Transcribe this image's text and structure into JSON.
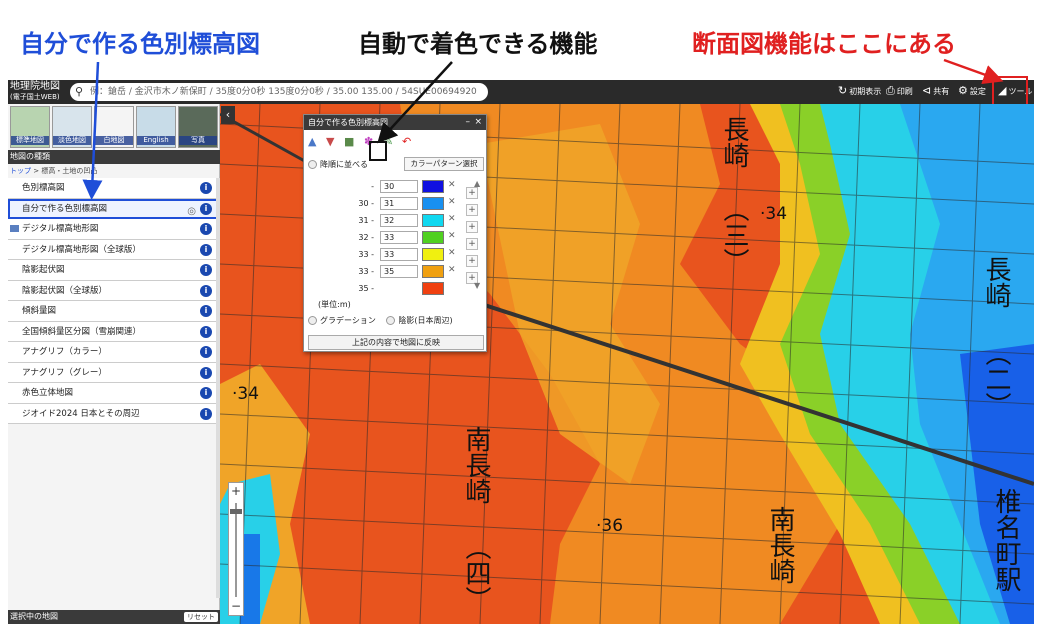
{
  "captions": {
    "left": "自分で作る色別標高図",
    "middle": "自動で着色できる機能",
    "right": "断面図機能はここにある"
  },
  "topbar": {
    "logo_main": "地理院地図",
    "logo_sub": "(電子国土WEB)",
    "search_text": "例：鎗岳 / 金沢市木ノ新保町 / 35度0分0秒 135度0分0秒 / 35.00 135.00 / 54SUE00694920",
    "btn_init": "初期表示",
    "btn_print": "印刷",
    "btn_share": "共有",
    "btn_settings": "設定",
    "btn_tools": "ツール"
  },
  "sidebar": {
    "thumbs": [
      "標準地図",
      "淡色地図",
      "白地図",
      "English",
      "写真"
    ],
    "section_title": "地図の種類",
    "breadcrumb_top": "トップ",
    "breadcrumb_rest": " > 標高・土地の凹凸",
    "layers": [
      {
        "label": "色別標高図",
        "folder": false,
        "highlight": false
      },
      {
        "label": "自分で作る色別標高図",
        "folder": false,
        "highlight": true
      },
      {
        "label": "デジタル標高地形図",
        "folder": true,
        "highlight": false
      },
      {
        "label": "デジタル標高地形図（全球版）",
        "folder": false,
        "highlight": false
      },
      {
        "label": "陰影起伏図",
        "folder": false,
        "highlight": false
      },
      {
        "label": "陰影起伏図（全球版）",
        "folder": false,
        "highlight": false
      },
      {
        "label": "傾斜量図",
        "folder": false,
        "highlight": false
      },
      {
        "label": "全国傾斜量区分図（雪崩関連）",
        "folder": false,
        "highlight": false
      },
      {
        "label": "アナグリフ（カラー）",
        "folder": false,
        "highlight": false
      },
      {
        "label": "アナグリフ（グレー）",
        "folder": false,
        "highlight": false
      },
      {
        "label": "赤色立体地図",
        "folder": false,
        "highlight": false
      },
      {
        "label": "ジオイド2024 日本とその周辺",
        "folder": false,
        "highlight": false
      }
    ],
    "selected_title": "選択中の地図",
    "reset_label": "リセット"
  },
  "panel": {
    "title": "自分で作る色別標高図",
    "sort_label": "降順に並べる",
    "pattern_label": "カラーパターン選択",
    "rows": [
      {
        "from": "",
        "to": "30",
        "color": "#1010e0"
      },
      {
        "from": "30",
        "to": "31",
        "color": "#1890f0"
      },
      {
        "from": "31",
        "to": "32",
        "color": "#10d8f0"
      },
      {
        "from": "32",
        "to": "33",
        "color": "#50d020"
      },
      {
        "from": "33",
        "to": "33",
        "color": "#f0f010"
      },
      {
        "from": "33",
        "to": "35",
        "color": "#f0a010"
      },
      {
        "from": "35",
        "to": "",
        "color": "#f04010"
      }
    ],
    "unit": "(単位:m)",
    "gradation": "グラデーション",
    "shading": "陰影(日本周辺)",
    "apply": "上記の内容で地図に反映"
  },
  "map": {
    "labels": {
      "nagasaki1": "長崎",
      "nagasaki3": "（三）",
      "elev34a": "·34",
      "nagasaki_right": "長崎",
      "nagasaki2": "（二）",
      "elev34b": "·34",
      "minaminagasaki": "南長崎",
      "yon": "（四）",
      "elev36": "·36",
      "minaminagasaki2": "南長崎",
      "shiinamachi": "椎名町駅",
      "station": "駅"
    }
  },
  "colors": {
    "caption_blue": "#1f4ed8",
    "caption_red": "#e02020",
    "map_red": "#e8541e",
    "map_orange": "#f09020",
    "map_cyan": "#28d0e8",
    "map_blue": "#1878e8"
  }
}
